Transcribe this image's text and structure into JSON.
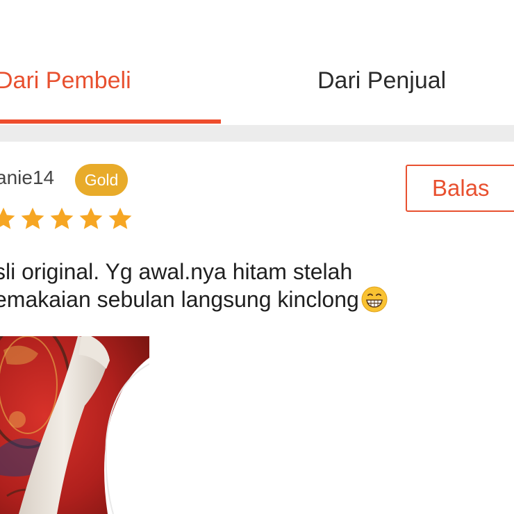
{
  "tabs": [
    {
      "label": "Dari Pembeli",
      "active": true
    },
    {
      "label": "Dari Penjual",
      "active": false
    }
  ],
  "review": {
    "username": "anie14",
    "badge": "Gold",
    "reply_label": "Balas",
    "rating": 5,
    "rating_icon": "star-icon",
    "comment_lines": [
      "sli original. Yg awal.nya hitam stelah",
      "emakaian sebulan langsung kinclong"
    ],
    "comment_emoji": "grinning-face-emoji",
    "photo": "review-photo"
  },
  "colors": {
    "accent": "#ee4d2d",
    "star": "#f6a623",
    "badge": "#e8ab2a",
    "divider": "#ececec"
  }
}
